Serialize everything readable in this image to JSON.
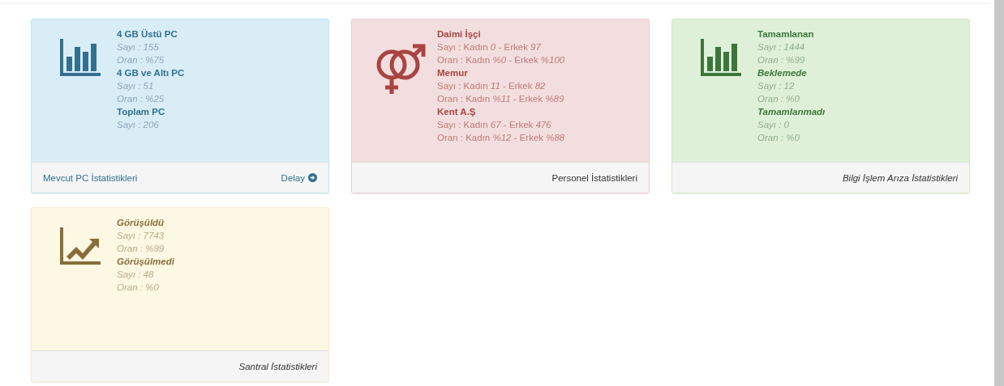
{
  "cards": [
    {
      "kind": "info",
      "lines": [
        {
          "kind": "heading",
          "text": "4 GB Üstü PC",
          "italic": false
        },
        {
          "kind": "stat",
          "text": "Sayı : 155",
          "italic": true
        },
        {
          "kind": "stat",
          "text": "Oran : %75",
          "italic": true
        },
        {
          "kind": "heading",
          "text": "4 GB ve Altı PC",
          "italic": false
        },
        {
          "kind": "stat",
          "text": "Sayı : 51",
          "italic": true
        },
        {
          "kind": "stat",
          "text": "Oran : %25",
          "italic": true
        },
        {
          "kind": "heading",
          "text": "Toplam PC",
          "italic": false
        },
        {
          "kind": "stat",
          "text": "Sayı : 206",
          "italic": true
        }
      ],
      "footer": {
        "label": "Mevcut PC İstatistikleri",
        "italic": false,
        "link": "Delay"
      }
    },
    {
      "kind": "danger",
      "lines": [
        {
          "kind": "heading",
          "text": "Daimi İşçi",
          "italic": false
        },
        {
          "kind": "stat",
          "text": "Sayı : Kadın *0* - Erkek *97*",
          "italic": false
        },
        {
          "kind": "stat",
          "text": "Oran : Kadın *%0* - Erkek *%100*",
          "italic": false
        },
        {
          "kind": "heading",
          "text": "Memur",
          "italic": false
        },
        {
          "kind": "stat",
          "text": "Sayı : Kadın *11* - Erkek *82*",
          "italic": false
        },
        {
          "kind": "stat",
          "text": "Oran : Kadın *%11* - Erkek *%89*",
          "italic": false
        },
        {
          "kind": "heading",
          "text": "Kent A.Ş",
          "italic": false
        },
        {
          "kind": "stat",
          "text": "Sayı : Kadın *67* - Erkek *476*",
          "italic": false
        },
        {
          "kind": "stat",
          "text": "Oran : Kadın *%12* - Erkek *%88*",
          "italic": false
        }
      ],
      "footer": {
        "label": "Personel İstatistikleri",
        "italic": false
      }
    },
    {
      "kind": "success",
      "lines": [
        {
          "kind": "heading",
          "text": "Tamamlanan",
          "italic": false
        },
        {
          "kind": "stat",
          "text": "Sayı : 1444",
          "italic": true
        },
        {
          "kind": "stat",
          "text": "Oran : %99",
          "italic": true
        },
        {
          "kind": "heading",
          "text": "Beklemede",
          "italic": true
        },
        {
          "kind": "stat",
          "text": "Sayı : 12",
          "italic": true
        },
        {
          "kind": "stat",
          "text": "Oran : %0",
          "italic": true
        },
        {
          "kind": "heading",
          "text": "Tamamlanmadı",
          "italic": true
        },
        {
          "kind": "stat",
          "text": "Sayı : 0",
          "italic": true
        },
        {
          "kind": "stat",
          "text": "Oran : %0",
          "italic": true
        }
      ],
      "footer": {
        "label": "Bilgi İşlem Arıza İstatistikleri",
        "italic": true
      }
    },
    {
      "kind": "warning",
      "lines": [
        {
          "kind": "heading",
          "text": "Görüşüldü",
          "italic": true
        },
        {
          "kind": "stat",
          "text": "Sayı : 7743",
          "italic": true
        },
        {
          "kind": "stat",
          "text": "Oran : %99",
          "italic": true
        },
        {
          "kind": "heading",
          "text": "Görüşülmedi",
          "italic": true
        },
        {
          "kind": "stat",
          "text": "Sayı : 48",
          "italic": true
        },
        {
          "kind": "stat",
          "text": "Oran : %0",
          "italic": true
        }
      ],
      "footer": {
        "label": "Santral İstatistikleri",
        "italic": true
      }
    }
  ]
}
